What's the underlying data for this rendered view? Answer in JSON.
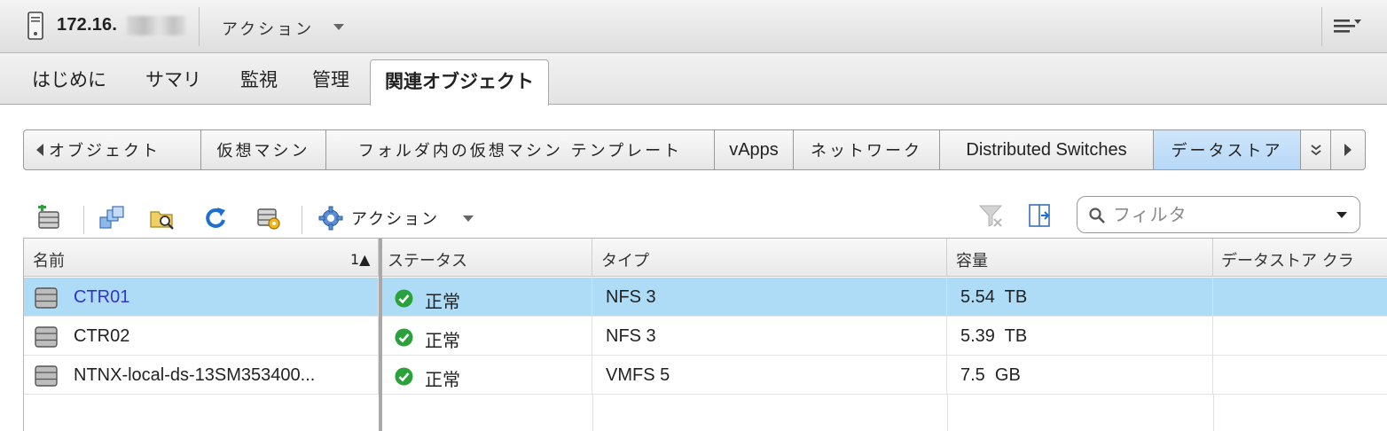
{
  "header": {
    "host_name": "172.16.",
    "actions_label": "アクション"
  },
  "main_tabs": [
    {
      "label": "はじめに"
    },
    {
      "label": "サマリ"
    },
    {
      "label": "監視"
    },
    {
      "label": "管理"
    },
    {
      "label": "関連オブジェクト",
      "active": true
    }
  ],
  "sub_tabs": [
    {
      "label": "オブジェクト"
    },
    {
      "label": "仮想マシン"
    },
    {
      "label": "フォルダ内の仮想マシン テンプレート"
    },
    {
      "label": "vApps"
    },
    {
      "label": "ネットワーク"
    },
    {
      "label": "Distributed Switches"
    },
    {
      "label": "データストア",
      "active": true
    }
  ],
  "toolbar": {
    "actions_label": "アクション",
    "filter_placeholder": "フィルタ"
  },
  "grid": {
    "columns": [
      {
        "label": "名前"
      },
      {
        "label": "ステータス"
      },
      {
        "label": "タイプ"
      },
      {
        "label": "容量"
      },
      {
        "label": "データストア クラ"
      }
    ],
    "sort_indicator": "1▲",
    "rows": [
      {
        "name": "CTR01",
        "status": "正常",
        "type": "NFS 3",
        "capacity": "5.54  TB",
        "selected": true
      },
      {
        "name": "CTR02",
        "status": "正常",
        "type": "NFS 3",
        "capacity": "5.39  TB"
      },
      {
        "name": "NTNX-local-ds-13SM353400...",
        "status": "正常",
        "type": "VMFS 5",
        "capacity": "7.5  GB"
      }
    ]
  },
  "colors": {
    "selected_row": "#aedcf7",
    "active_subtab": "#b6d8f7",
    "link": "#3333cc",
    "status_ok": "#2aa13a",
    "refresh_icon": "#1f6fd1"
  }
}
